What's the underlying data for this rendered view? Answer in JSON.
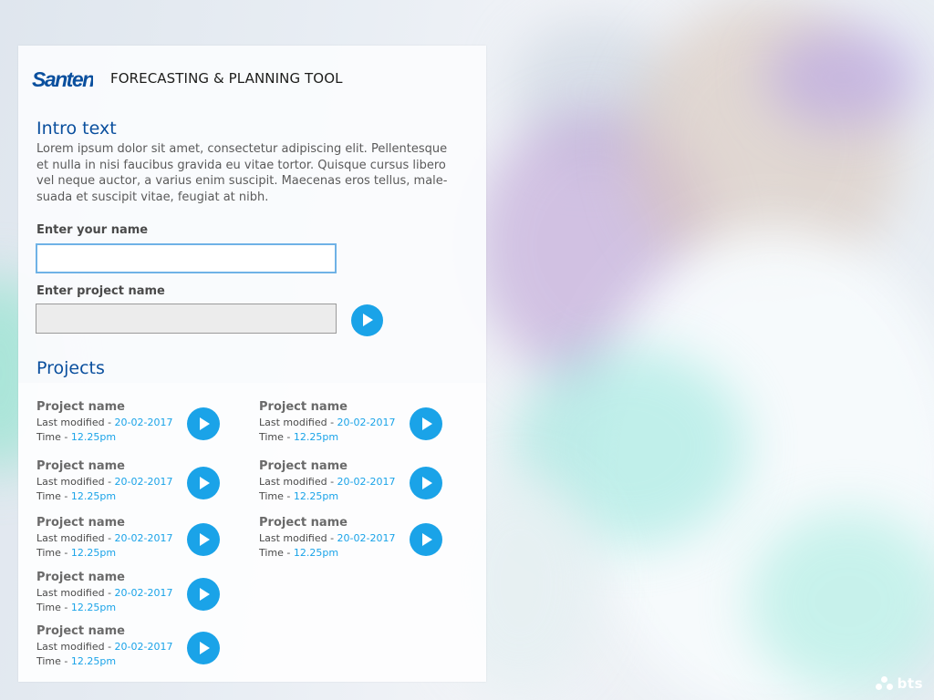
{
  "brand": {
    "logo_text": "Santen",
    "app_title": "FORECASTING & PLANNING TOOL",
    "colors": {
      "primary": "#0a4f9e",
      "accent": "#1aa3e8",
      "text": "#5a5a5a"
    }
  },
  "intro": {
    "title": "Intro text",
    "body": "Lorem ipsum dolor sit amet, consectetur adipiscing elit. Pellentesque et nulla in nisi faucibus gravida eu vitae tortor. Quisque cursus libero vel neque auctor, a varius enim suscipit. Maecenas eros tellus, male-suada et suscipit vitae, feugiat at nibh."
  },
  "form": {
    "name_label": "Enter your name",
    "name_value": "",
    "project_label": "Enter project name",
    "project_value": "",
    "go_icon": "play-icon"
  },
  "projects": {
    "title": "Projects",
    "items": [
      {
        "name": "Project name",
        "modified_label": "Last modified - ",
        "modified_date": "20-02-2017",
        "time_label": "Time - ",
        "time": "12.25pm"
      },
      {
        "name": "Project name",
        "modified_label": "Last modified - ",
        "modified_date": "20-02-2017",
        "time_label": "Time - ",
        "time": "12.25pm"
      },
      {
        "name": "Project name",
        "modified_label": "Last modified - ",
        "modified_date": "20-02-2017",
        "time_label": "Time - ",
        "time": "12.25pm"
      },
      {
        "name": "Project name",
        "modified_label": "Last modified - ",
        "modified_date": "20-02-2017",
        "time_label": "Time - ",
        "time": "12.25pm"
      },
      {
        "name": "Project name",
        "modified_label": "Last modified - ",
        "modified_date": "20-02-2017",
        "time_label": "Time - ",
        "time": "12.25pm"
      },
      {
        "name": "Project name",
        "modified_label": "Last modified - ",
        "modified_date": "20-02-2017",
        "time_label": "Time - ",
        "time": "12.25pm"
      },
      {
        "name": "Project name",
        "modified_label": "Last modified - ",
        "modified_date": "20-02-2017",
        "time_label": "Time - ",
        "time": "12.25pm"
      },
      {
        "name": "Project name",
        "modified_label": "Last modified - ",
        "modified_date": "20-02-2017",
        "time_label": "Time - ",
        "time": "12.25pm"
      }
    ]
  },
  "footer": {
    "vendor_mark": "bts"
  }
}
